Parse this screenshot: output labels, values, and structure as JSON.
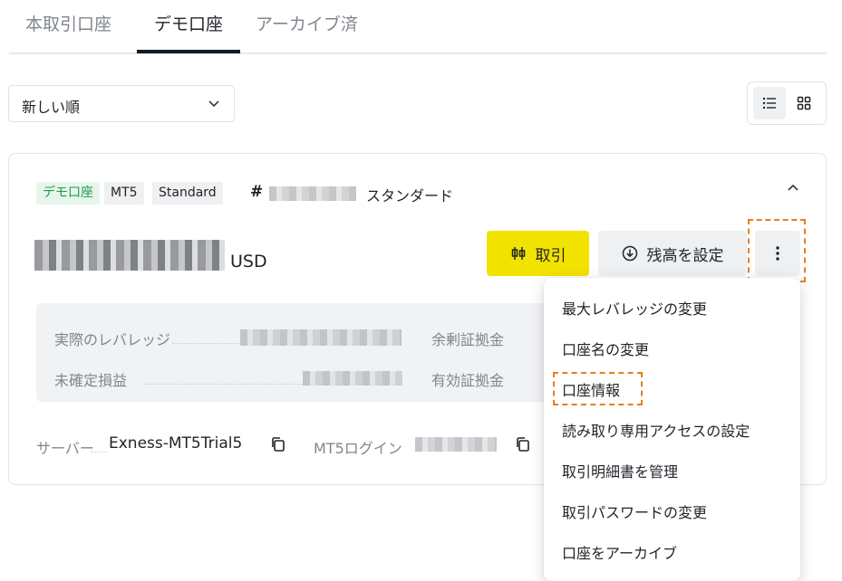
{
  "tabs": [
    {
      "label": "本取引口座"
    },
    {
      "label": "デモ口座"
    },
    {
      "label": "アーカイブ済"
    }
  ],
  "sort": {
    "selected": "新しい順"
  },
  "account": {
    "badges": [
      "デモ口座",
      "MT5",
      "Standard"
    ],
    "hash": "#",
    "type_label": "スタンダード",
    "currency": "USD",
    "actions": {
      "trade": "取引",
      "set_balance": "残高を設定"
    },
    "stats": {
      "actual_leverage": "実際のレバレッジ",
      "unrealized_pnl": "未確定損益",
      "free_margin": "余剰証拠金",
      "equity": "有効証拠金"
    },
    "server_label": "サーバー",
    "server_value": "Exness-MT5Trial5",
    "login_label": "MT5ログイン"
  },
  "menu": {
    "items": [
      "最大レバレッジの変更",
      "口座名の変更",
      "口座情報",
      "読み取り専用アクセスの設定",
      "取引明細書を管理",
      "取引パスワードの変更",
      "口座をアーカイブ"
    ]
  },
  "colors": {
    "accent_yellow": "#f2e200",
    "highlight_orange": "#e67e22",
    "demo_green": "#1e9a4a",
    "tab_active": "#141d22"
  }
}
